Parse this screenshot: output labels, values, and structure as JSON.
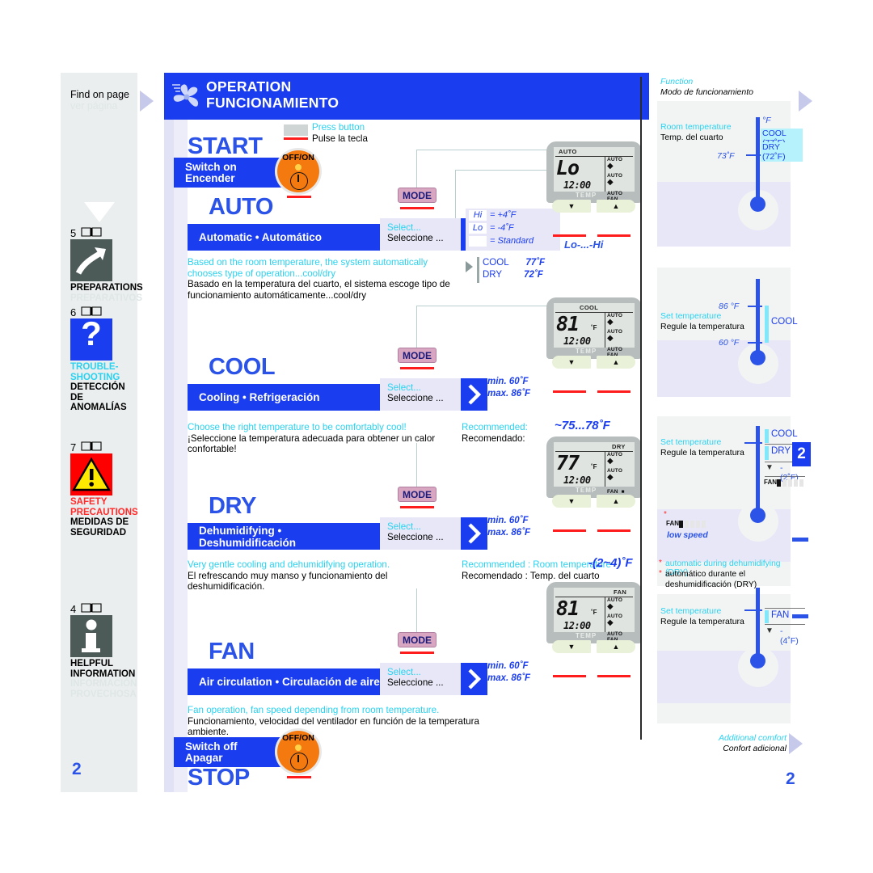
{
  "sidebar": {
    "find_en": "Find on page",
    "find_es": "ver página",
    "items": [
      {
        "page": "5",
        "icon": "preparations-icon",
        "en": "PREPARATIONS",
        "es": "PREPARATIVOS"
      },
      {
        "page": "6",
        "icon": "question-mark-icon",
        "en_l1": "TROUBLE-",
        "en_l2": "SHOOTING",
        "es_l1": "DETECCIÓN",
        "es_l2": "DE ANOMALÍAS"
      },
      {
        "page": "7",
        "icon": "warning-triangle-icon",
        "en_l1": "SAFETY",
        "en_l2": "PRECAUTIONS",
        "es_l1": "MEDIDAS DE",
        "es_l2": "SEGURIDAD"
      },
      {
        "page": "4",
        "icon": "info-icon",
        "en_l1": "HELPFUL",
        "en_l2": "INFORMATION",
        "es_l1": "INFORMACIÓN",
        "es_l2": "PROVECHOSA"
      }
    ],
    "page_number": "2"
  },
  "header": {
    "title_en": "OPERATION",
    "title_es": "FUNCIONAMIENTO",
    "icon": "fan-icon"
  },
  "start": {
    "title": "START",
    "bar_en": "Switch on",
    "bar_es": "Encender",
    "press_en": "Press button",
    "press_es": "Pulse la tecla",
    "button_label": "OFF/ON"
  },
  "stop": {
    "title": "STOP",
    "bar_en": "Switch off",
    "bar_es": "Apagar",
    "button_label": "OFF/ON"
  },
  "select": {
    "en": "Select...",
    "es": "Seleccione ..."
  },
  "mode_button": "MODE",
  "sections": [
    {
      "key": "auto",
      "title": "AUTO",
      "bar": "Automatic • Automático",
      "desc_en": "Based on the room temperature, the system automatically chooses type of operation...cool/dry",
      "desc_es": "Basado en la temperatura del cuarto, el sistema escoge tipo de funcionamiento automáticamente...cool/dry",
      "remote": {
        "mode": "AUTO",
        "value": "Lo",
        "unit": "",
        "clock": "12:00",
        "r1": "AUTO",
        "r2": "AUTO",
        "r3_a": "AUTO",
        "r3_b": "FAN",
        "fan_bar": false
      },
      "range_label": "Lo-...-Hi",
      "hi_key": "Hi",
      "hi_val": "= +4˚F",
      "lo_key": "Lo",
      "lo_val": "= -4˚F",
      "std_val": "= Standard",
      "cool_label": "COOL",
      "cool_val": "77˚F",
      "dry_label": "DRY",
      "dry_val": "72˚F"
    },
    {
      "key": "cool",
      "title": "COOL",
      "bar": "Cooling • Refrigeración",
      "desc_en": "Choose the right temperature to be comfortably cool!",
      "desc_es": "¡Seleccione la temperatura adecuada para obtener un calor confortable!",
      "remote": {
        "mode": "COOL",
        "value": "81",
        "unit": "˚F",
        "clock": "12:00",
        "r1": "AUTO",
        "r2": "AUTO",
        "r3_a": "AUTO",
        "r3_b": "FAN",
        "fan_bar": false
      },
      "min": "min. 60˚F",
      "max": "max. 86˚F",
      "rec_en": "Recommended:",
      "rec_es": "Recomendado:",
      "rec_val": "~75...78˚F"
    },
    {
      "key": "dry",
      "title": "DRY",
      "bar": "Dehumidifying • Deshumidificación",
      "desc_en": "Very gentle cooling and dehumidifying operation.",
      "desc_es": "El refrescando muy manso y funcionamiento del deshumidificación.",
      "remote": {
        "mode": "DRY",
        "value": "77",
        "unit": "˚F",
        "clock": "12:00",
        "r1": "AUTO",
        "r2": "AUTO",
        "r3_a": "FAN",
        "r3_b": "",
        "fan_bar": true
      },
      "min": "min. 60˚F",
      "max": "max. 86˚F",
      "rec_en": "Recommended : Room temperature",
      "rec_es": "Recomendado  : Temp. del cuarto",
      "rec_val": "-(2~4)˚F"
    },
    {
      "key": "fan",
      "title": "FAN",
      "bar": "Air circulation • Circulación de aire",
      "desc_en": "Fan operation, fan speed depending from room temperature.",
      "desc_es": "Funcionamiento, velocidad del ventilador en función de la temperatura ambiente.",
      "remote": {
        "mode": "FAN",
        "value": "81",
        "unit": "˚F",
        "clock": "12:00",
        "r1": "AUTO",
        "r2": "AUTO",
        "r3_a": "AUTO",
        "r3_b": "FAN",
        "fan_bar": false
      },
      "min": "min. 60˚F",
      "max": "max. 86˚F"
    }
  ],
  "right_panel": {
    "function_en": "Function",
    "function_es": "Modo de funcionamiento",
    "auto": {
      "cap_en": "Room temperature",
      "cap_es": "Temp. del cuarto",
      "unit": "°F",
      "room_value": "73˚F",
      "chip_cool": "COOL (77˚F)",
      "chip_dry": "DRY   (72˚F)"
    },
    "cool": {
      "cap_en": "Set temperature",
      "cap_es": "Regule la temperatura",
      "max": "86 °F",
      "min": "60 °F",
      "mode": "COOL"
    },
    "dry": {
      "cap_en": "Set temperature",
      "cap_es": "Regule la temperatura",
      "mode_1": "COOL",
      "mode_2": "DRY",
      "offset": "-(2˚F)",
      "fan_label": "FAN",
      "note_fan_label": "FAN",
      "note_low_speed": "low speed",
      "foot_en": "automatic during dehumidifying (DRY)",
      "foot_es_l1": "automático durante el",
      "foot_es_l2": "deshumidificación (DRY)"
    },
    "fan": {
      "cap_en": "Set temperature",
      "cap_es": "Regule la temperatura",
      "mode": "FAN",
      "offset": "-(4˚F)"
    },
    "footer_en": "Additional comfort",
    "footer_es": "Confort adicional",
    "chip": "2",
    "page_number": "2"
  }
}
